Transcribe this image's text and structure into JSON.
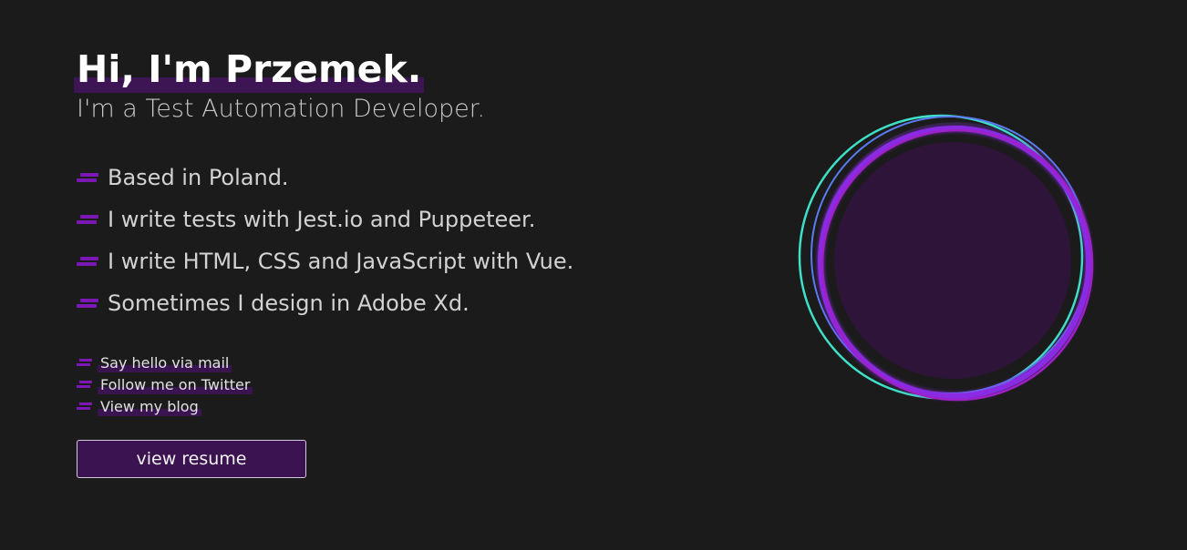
{
  "hero": {
    "greeting": "Hi, I'm Przemek.",
    "role": "I'm a Test Automation Developer."
  },
  "facts": [
    "Based in Poland.",
    "I write tests with Jest.io and Puppeteer.",
    "I write HTML, CSS and JavaScript with Vue.",
    "Sometimes I design in Adobe Xd."
  ],
  "links": [
    "Say hello via mail",
    "Follow me on Twitter",
    "View my blog"
  ],
  "cta": {
    "resume_label": "view resume"
  },
  "colors": {
    "background": "#1b1b1b",
    "accent_purple": "#7b17b5",
    "highlight": "#3e1554",
    "ring_teal": "#3fe0c8",
    "ring_violet": "#8a2be2",
    "avatar_fill": "#2e1438"
  }
}
